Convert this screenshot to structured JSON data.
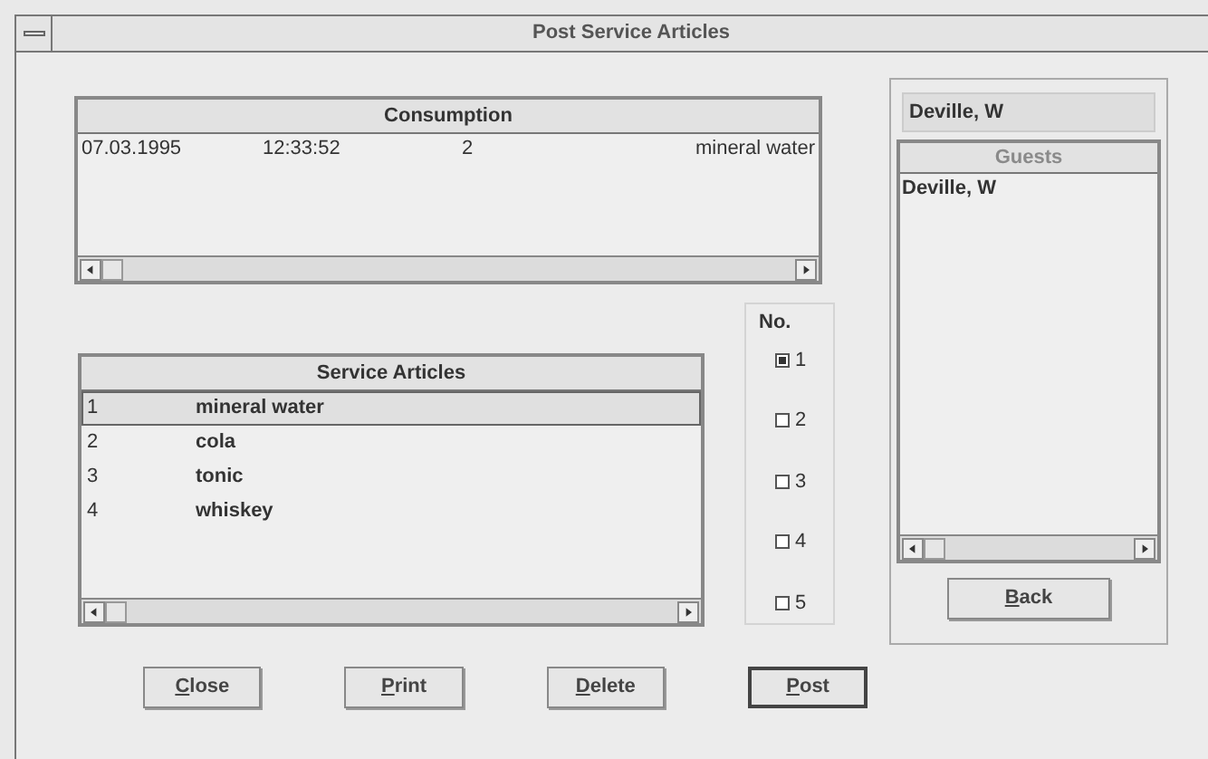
{
  "window": {
    "title": "Post Service Articles"
  },
  "consumption": {
    "header": "Consumption",
    "rows": [
      {
        "cells": [
          "07.03.1995",
          "12:33:52",
          "2",
          "mineral water"
        ]
      }
    ]
  },
  "service_articles": {
    "header": "Service Articles",
    "rows": [
      {
        "number": "1",
        "name": "mineral water",
        "selected": true
      },
      {
        "number": "2",
        "name": "cola",
        "selected": false
      },
      {
        "number": "3",
        "name": "tonic",
        "selected": false
      },
      {
        "number": "4",
        "name": "whiskey",
        "selected": false
      }
    ]
  },
  "quantity": {
    "label": "No.",
    "options": [
      {
        "label": "1",
        "selected": true
      },
      {
        "label": "2",
        "selected": false
      },
      {
        "label": "3",
        "selected": false
      },
      {
        "label": "4",
        "selected": false
      },
      {
        "label": "5",
        "selected": false
      }
    ]
  },
  "guest_field": {
    "value": "Deville, W"
  },
  "guests": {
    "header": "Guests",
    "disabled": true,
    "rows": [
      {
        "name": "Deville, W"
      }
    ]
  },
  "back_button": {
    "access_key": "B",
    "label_rest": "ack"
  },
  "buttons": [
    {
      "access_key": "C",
      "label_rest": "lose",
      "default": false
    },
    {
      "access_key": "P",
      "label_rest": "rint",
      "default": false
    },
    {
      "access_key": "D",
      "label_rest": "elete",
      "default": false
    },
    {
      "access_key": "P",
      "label_rest": "ost",
      "default": true
    }
  ]
}
